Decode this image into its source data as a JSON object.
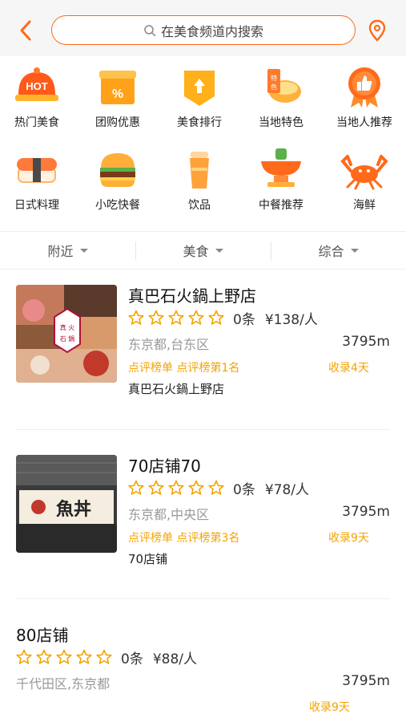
{
  "header": {
    "search_placeholder": "在美食频道内搜索",
    "back_icon": "chevron-left-icon",
    "location_icon": "location-pin-icon",
    "accent_color": "#ff6a1a"
  },
  "categories": [
    {
      "label": "热门美食",
      "icon": "hot-dish-icon"
    },
    {
      "label": "团购优惠",
      "icon": "coupon-box-icon"
    },
    {
      "label": "美食排行",
      "icon": "ranking-badge-icon"
    },
    {
      "label": "当地特色",
      "icon": "local-special-icon"
    },
    {
      "label": "当地人推荐",
      "icon": "thumbs-up-medal-icon"
    },
    {
      "label": "日式料理",
      "icon": "sushi-icon"
    },
    {
      "label": "小吃快餐",
      "icon": "burger-icon"
    },
    {
      "label": "饮品",
      "icon": "drink-cup-icon"
    },
    {
      "label": "中餐推荐",
      "icon": "hotpot-icon"
    },
    {
      "label": "海鲜",
      "icon": "crab-icon"
    }
  ],
  "filters": [
    {
      "label": "附近"
    },
    {
      "label": "美食"
    },
    {
      "label": "综合"
    }
  ],
  "listings": [
    {
      "name": "真巴石火鍋上野店",
      "rating_stars": 0,
      "reviews": "0条",
      "price": "¥138/人",
      "area": "东京都,台东区",
      "distance": "3795m",
      "rank": "点评榜单 点评榜第1名",
      "saved": "收录4天",
      "subname": "真巴石火鍋上野店",
      "thumb_text": "真巴石火鍋"
    },
    {
      "name": "70店铺70",
      "rating_stars": 0,
      "reviews": "0条",
      "price": "¥78/人",
      "area": "东京都,中央区",
      "distance": "3795m",
      "rank": "点评榜单 点评榜第3名",
      "saved": "收录9天",
      "subname": "70店铺",
      "thumb_text": "魚丼"
    },
    {
      "name": "80店铺",
      "rating_stars": 0,
      "reviews": "0条",
      "price": "¥88/人",
      "area": "千代田区,东京都",
      "distance": "3795m",
      "saved": "收录9天"
    }
  ]
}
